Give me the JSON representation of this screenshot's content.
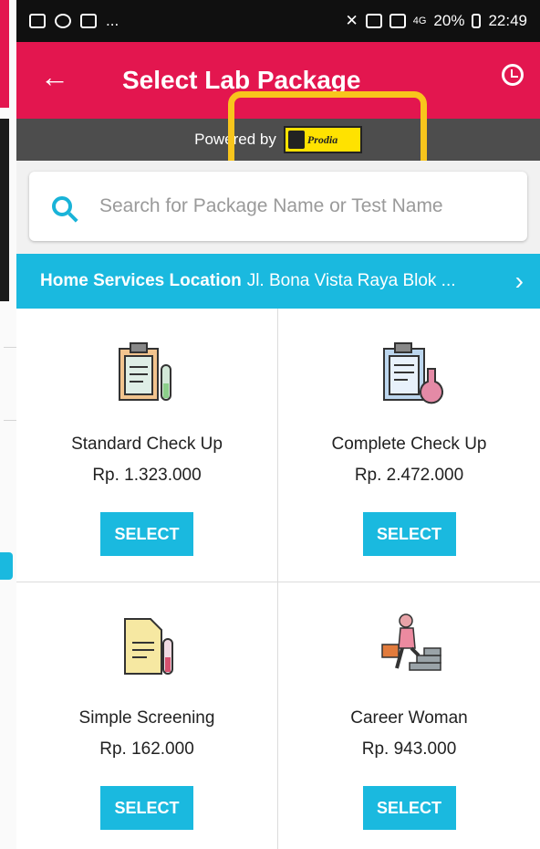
{
  "status_bar": {
    "left_extra": "...",
    "network": "4G",
    "battery": "20%",
    "time": "22:49"
  },
  "header": {
    "title": "Select Lab Package",
    "back_icon": "arrow-left-icon",
    "history_icon": "history-icon"
  },
  "powered_by": {
    "label": "Powered by",
    "logo_text": "Prodia"
  },
  "search": {
    "placeholder": "Search for Package Name or Test Name"
  },
  "location": {
    "label": "Home Services Location",
    "address": "Jl. Bona Vista Raya Blok ..."
  },
  "packages": [
    {
      "name": "Standard Check Up",
      "price": "Rp. 1.323.000",
      "button": "SELECT"
    },
    {
      "name": "Complete Check Up",
      "price": "Rp. 2.472.000",
      "button": "SELECT"
    },
    {
      "name": "Simple Screening",
      "price": "Rp. 162.000",
      "button": "SELECT"
    },
    {
      "name": "Career Woman",
      "price": "Rp. 943.000",
      "button": "SELECT"
    }
  ],
  "colors": {
    "brand_red": "#e3164f",
    "accent_blue": "#1ab9df",
    "highlight_yellow": "#f8c51c"
  }
}
